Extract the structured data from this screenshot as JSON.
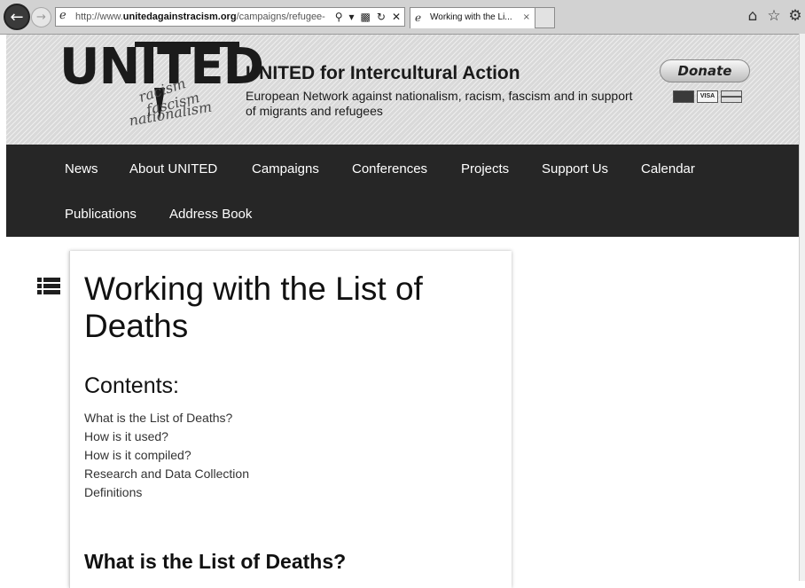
{
  "browser": {
    "url_prefix": "http://www.",
    "url_domain": "unitedagainstracism.org",
    "url_path": "/campaigns/refugee-c",
    "tab_title": "Working with the Li...",
    "tab_close": "×",
    "icons": [
      "back-arrow-icon",
      "forward-arrow-icon",
      "ie-page-icon",
      "search-icon",
      "dropdown-icon",
      "compatibility-icon",
      "refresh-icon",
      "stop-icon",
      "home-icon",
      "favorites-star-icon",
      "settings-gear-icon"
    ]
  },
  "header": {
    "logo_text": "UNITED",
    "logo_words": [
      "racism",
      "fascism",
      "nationalism"
    ],
    "title": "UNITED for Intercultural Action",
    "tagline": "European Network against nationalism, racism, fascism and in support of migrants and refugees",
    "donate_label": "Donate",
    "card_labels": [
      "",
      "VISA",
      ""
    ]
  },
  "nav": {
    "items": [
      "News",
      "About UNITED",
      "Campaigns",
      "Conferences",
      "Projects",
      "Support Us",
      "Calendar",
      "Publications",
      "Address Book"
    ]
  },
  "content": {
    "page_title": "Working with the List of Deaths",
    "contents_heading": "Contents:",
    "toc": [
      "What is the List of Deaths?",
      "How is it used?",
      "How is it compiled?",
      "Research and Data Collection",
      "Definitions"
    ],
    "section_heading": "What is the List of Deaths?"
  },
  "colors": {
    "nav_bg": "#262626",
    "header_bg": "#d9d9d9",
    "link_text": "#333333"
  }
}
